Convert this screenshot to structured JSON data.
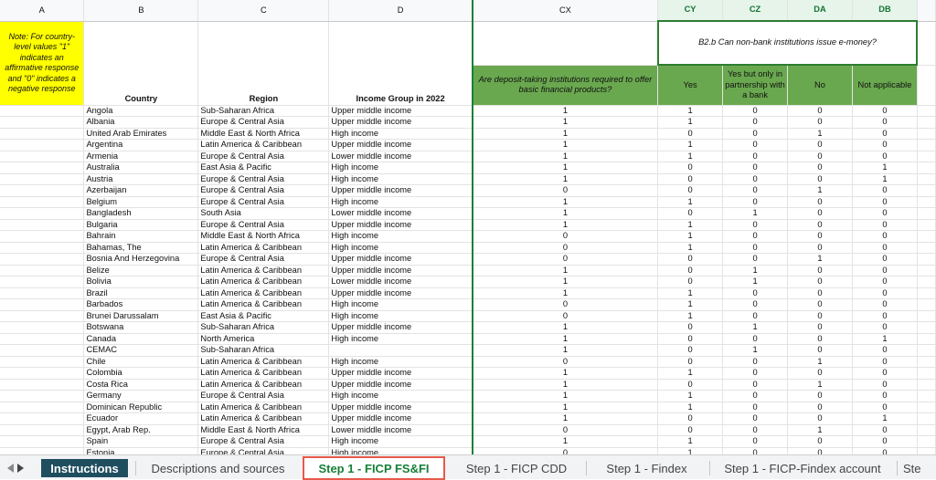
{
  "columns": {
    "a": "A",
    "b": "B",
    "c": "C",
    "d": "D",
    "cx": "CX",
    "cy": "CY",
    "cz": "CZ",
    "da": "DA",
    "db": "DB"
  },
  "header": {
    "note": "Note: For country-level values \"1\" indicates an affirmative response and \"0\" indicates a negative response",
    "country": "Country",
    "region": "Region",
    "income": "Income Group in 2022",
    "cx_question": "Are deposit-taking institutions required to offer basic financial products?",
    "b2b_question": "B2.b Can non-bank institutions issue e-money?",
    "opt_yes": "Yes",
    "opt_partner": "Yes but only in partnership with a bank",
    "opt_no": "No",
    "opt_na": "Not applicable"
  },
  "rows": [
    {
      "country": "Angola",
      "region": "Sub-Saharan Africa",
      "income": "Upper middle income",
      "cx": "1",
      "cy": "1",
      "cz": "0",
      "da": "0",
      "db": "0"
    },
    {
      "country": "Albania",
      "region": "Europe & Central Asia",
      "income": "Upper middle income",
      "cx": "1",
      "cy": "1",
      "cz": "0",
      "da": "0",
      "db": "0"
    },
    {
      "country": "United Arab Emirates",
      "region": "Middle East & North Africa",
      "income": "High income",
      "cx": "1",
      "cy": "0",
      "cz": "0",
      "da": "1",
      "db": "0"
    },
    {
      "country": "Argentina",
      "region": "Latin America & Caribbean",
      "income": "Upper middle income",
      "cx": "1",
      "cy": "1",
      "cz": "0",
      "da": "0",
      "db": "0"
    },
    {
      "country": "Armenia",
      "region": "Europe & Central Asia",
      "income": "Lower middle income",
      "cx": "1",
      "cy": "1",
      "cz": "0",
      "da": "0",
      "db": "0"
    },
    {
      "country": "Australia",
      "region": "East Asia & Pacific",
      "income": "High income",
      "cx": "1",
      "cy": "0",
      "cz": "0",
      "da": "0",
      "db": "1"
    },
    {
      "country": "Austria",
      "region": "Europe & Central Asia",
      "income": "High income",
      "cx": "1",
      "cy": "0",
      "cz": "0",
      "da": "0",
      "db": "1"
    },
    {
      "country": "Azerbaijan",
      "region": "Europe & Central Asia",
      "income": "Upper middle income",
      "cx": "0",
      "cy": "0",
      "cz": "0",
      "da": "1",
      "db": "0"
    },
    {
      "country": "Belgium",
      "region": "Europe & Central Asia",
      "income": "High income",
      "cx": "1",
      "cy": "1",
      "cz": "0",
      "da": "0",
      "db": "0"
    },
    {
      "country": "Bangladesh",
      "region": "South Asia",
      "income": "Lower middle income",
      "cx": "1",
      "cy": "0",
      "cz": "1",
      "da": "0",
      "db": "0"
    },
    {
      "country": "Bulgaria",
      "region": "Europe & Central Asia",
      "income": "Upper middle income",
      "cx": "1",
      "cy": "1",
      "cz": "0",
      "da": "0",
      "db": "0"
    },
    {
      "country": "Bahrain",
      "region": "Middle East & North Africa",
      "income": "High income",
      "cx": "0",
      "cy": "1",
      "cz": "0",
      "da": "0",
      "db": "0"
    },
    {
      "country": "Bahamas, The",
      "region": "Latin America & Caribbean",
      "income": "High income",
      "cx": "0",
      "cy": "1",
      "cz": "0",
      "da": "0",
      "db": "0"
    },
    {
      "country": "Bosnia And Herzegovina",
      "region": "Europe & Central Asia",
      "income": "Upper middle income",
      "cx": "0",
      "cy": "0",
      "cz": "0",
      "da": "1",
      "db": "0"
    },
    {
      "country": "Belize",
      "region": "Latin America & Caribbean",
      "income": "Upper middle income",
      "cx": "1",
      "cy": "0",
      "cz": "1",
      "da": "0",
      "db": "0"
    },
    {
      "country": "Bolivia",
      "region": "Latin America & Caribbean",
      "income": "Lower middle income",
      "cx": "1",
      "cy": "0",
      "cz": "1",
      "da": "0",
      "db": "0"
    },
    {
      "country": "Brazil",
      "region": "Latin America & Caribbean",
      "income": "Upper middle income",
      "cx": "1",
      "cy": "1",
      "cz": "0",
      "da": "0",
      "db": "0"
    },
    {
      "country": "Barbados",
      "region": "Latin America & Caribbean",
      "income": "High income",
      "cx": "0",
      "cy": "1",
      "cz": "0",
      "da": "0",
      "db": "0"
    },
    {
      "country": "Brunei Darussalam",
      "region": "East Asia & Pacific",
      "income": "High income",
      "cx": "0",
      "cy": "1",
      "cz": "0",
      "da": "0",
      "db": "0"
    },
    {
      "country": "Botswana",
      "region": "Sub-Saharan Africa",
      "income": "Upper middle income",
      "cx": "1",
      "cy": "0",
      "cz": "1",
      "da": "0",
      "db": "0"
    },
    {
      "country": "Canada",
      "region": "North America",
      "income": "High income",
      "cx": "1",
      "cy": "0",
      "cz": "0",
      "da": "0",
      "db": "1"
    },
    {
      "country": "CEMAC",
      "region": "Sub-Saharan Africa",
      "income": "",
      "cx": "1",
      "cy": "0",
      "cz": "1",
      "da": "0",
      "db": "0"
    },
    {
      "country": "Chile",
      "region": "Latin America & Caribbean",
      "income": "High income",
      "cx": "0",
      "cy": "0",
      "cz": "0",
      "da": "1",
      "db": "0"
    },
    {
      "country": "Colombia",
      "region": "Latin America & Caribbean",
      "income": "Upper middle income",
      "cx": "1",
      "cy": "1",
      "cz": "0",
      "da": "0",
      "db": "0"
    },
    {
      "country": "Costa Rica",
      "region": "Latin America & Caribbean",
      "income": "Upper middle income",
      "cx": "1",
      "cy": "0",
      "cz": "0",
      "da": "1",
      "db": "0"
    },
    {
      "country": "Germany",
      "region": "Europe & Central Asia",
      "income": "High income",
      "cx": "1",
      "cy": "1",
      "cz": "0",
      "da": "0",
      "db": "0"
    },
    {
      "country": "Dominican Republic",
      "region": "Latin America & Caribbean",
      "income": "Upper middle income",
      "cx": "1",
      "cy": "1",
      "cz": "0",
      "da": "0",
      "db": "0"
    },
    {
      "country": "Ecuador",
      "region": "Latin America & Caribbean",
      "income": "Upper middle income",
      "cx": "1",
      "cy": "0",
      "cz": "0",
      "da": "0",
      "db": "1"
    },
    {
      "country": "Egypt, Arab Rep.",
      "region": "Middle East & North Africa",
      "income": "Lower middle income",
      "cx": "0",
      "cy": "0",
      "cz": "0",
      "da": "1",
      "db": "0"
    },
    {
      "country": "Spain",
      "region": "Europe & Central Asia",
      "income": "High income",
      "cx": "1",
      "cy": "1",
      "cz": "0",
      "da": "0",
      "db": "0"
    },
    {
      "country": "Estonia",
      "region": "Europe & Central Asia",
      "income": "High income",
      "cx": "0",
      "cy": "1",
      "cz": "0",
      "da": "0",
      "db": "0"
    }
  ],
  "tabs": {
    "prev_icon": "triangle-left",
    "next_icon": "triangle-right",
    "instructions": "Instructions",
    "descriptions": "Descriptions and sources",
    "ficp_fsfi": "Step 1 - FICP FS&FI",
    "ficp_cdd": "Step 1 - FICP CDD",
    "findex": "Step 1 - Findex",
    "ficp_findex_account": "Step 1 - FICP-Findex account",
    "step_more": "Ste"
  },
  "colors": {
    "accent_green": "#188038",
    "header_green": "#6aa84f",
    "note_yellow": "#ffff00",
    "active_tab": "#1f4e5f",
    "highlight_border": "#e8594a"
  }
}
